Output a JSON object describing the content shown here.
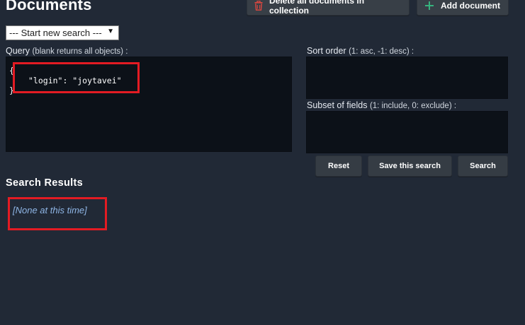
{
  "header": {
    "title": "Documents",
    "delete_all_label": "Delete all documents in collection",
    "add_document_label": "Add document"
  },
  "icons": {
    "delete": "trash-icon",
    "add": "plus-icon"
  },
  "colors": {
    "background": "#212936",
    "editor_background": "#0c1118",
    "trash_icon": "#e0473f",
    "plus_icon": "#36b37e",
    "highlight": "#e31b23",
    "empty_results_text": "#8fb6e6"
  },
  "search_select": {
    "selected": "--- Start new search ---"
  },
  "query": {
    "label": "Query",
    "hint": "(blank returns all objects) :",
    "open_brace": "{",
    "line": "\"login\": \"joytavei\"",
    "close_brace": "}"
  },
  "sort": {
    "label": "Sort order",
    "hint": "(1: asc, -1: desc) :"
  },
  "fields": {
    "label": "Subset of fields",
    "hint": "(1: include, 0: exclude) :"
  },
  "actions": {
    "reset": "Reset",
    "save": "Save this search",
    "search": "Search"
  },
  "results": {
    "title": "Search Results",
    "empty": "[None at this time]"
  }
}
